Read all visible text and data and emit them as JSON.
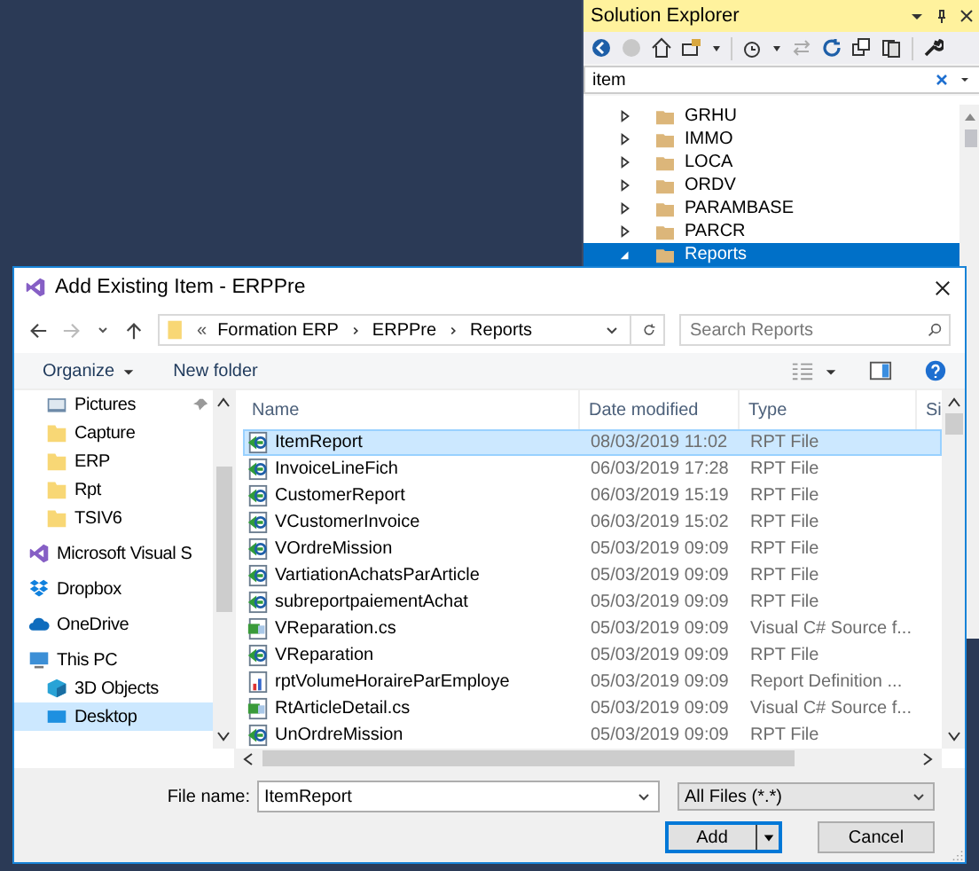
{
  "solution_explorer": {
    "title": "Solution Explorer",
    "search": {
      "value": "item"
    },
    "tree": [
      {
        "label": "GRHU",
        "expanded": false,
        "selected": false
      },
      {
        "label": "IMMO",
        "expanded": false,
        "selected": false
      },
      {
        "label": "LOCA",
        "expanded": false,
        "selected": false
      },
      {
        "label": "ORDV",
        "expanded": false,
        "selected": false
      },
      {
        "label": "PARAMBASE",
        "expanded": false,
        "selected": false
      },
      {
        "label": "PARCR",
        "expanded": false,
        "selected": false
      },
      {
        "label": "Reports",
        "expanded": true,
        "selected": true
      }
    ]
  },
  "dialog": {
    "title": "Add Existing Item - ERPPre",
    "address": {
      "overflow": "«",
      "crumbs": [
        "Formation ERP",
        "ERPPre",
        "Reports"
      ]
    },
    "search": {
      "placeholder": "Search Reports"
    },
    "toolbar": {
      "organize": "Organize",
      "new_folder": "New folder"
    },
    "quick_access": [
      {
        "label": "Pictures",
        "kind": "pictures",
        "pinned": true,
        "selected": false
      },
      {
        "label": "Capture",
        "kind": "folder",
        "pinned": false,
        "selected": false
      },
      {
        "label": "ERP",
        "kind": "folder",
        "pinned": false,
        "selected": false
      },
      {
        "label": "Rpt",
        "kind": "folder",
        "pinned": false,
        "selected": false
      },
      {
        "label": "TSIV6",
        "kind": "folder",
        "pinned": false,
        "selected": false
      }
    ],
    "locations": [
      {
        "label": "Microsoft Visual S",
        "kind": "vs",
        "selected": false
      },
      {
        "label": "Dropbox",
        "kind": "dropbox",
        "selected": false
      },
      {
        "label": "OneDrive",
        "kind": "onedrive",
        "selected": false
      },
      {
        "label": "This PC",
        "kind": "pc",
        "selected": false,
        "children": [
          {
            "label": "3D Objects",
            "kind": "objects3d",
            "selected": false
          },
          {
            "label": "Desktop",
            "kind": "desktop",
            "selected": true
          }
        ]
      }
    ],
    "columns": [
      "Name",
      "Date modified",
      "Type",
      "Si"
    ],
    "files": [
      {
        "name": "ItemReport",
        "date": "08/03/2019 11:02",
        "type": "RPT File",
        "kind": "rpt",
        "selected": true
      },
      {
        "name": "InvoiceLineFich",
        "date": "06/03/2019 17:28",
        "type": "RPT File",
        "kind": "rpt",
        "selected": false
      },
      {
        "name": "CustomerReport",
        "date": "06/03/2019 15:19",
        "type": "RPT File",
        "kind": "rpt",
        "selected": false
      },
      {
        "name": "VCustomerInvoice",
        "date": "06/03/2019 15:02",
        "type": "RPT File",
        "kind": "rpt",
        "selected": false
      },
      {
        "name": "VOrdreMission",
        "date": "05/03/2019 09:09",
        "type": "RPT File",
        "kind": "rpt",
        "selected": false
      },
      {
        "name": "VartiationAchatsParArticle",
        "date": "05/03/2019 09:09",
        "type": "RPT File",
        "kind": "rpt",
        "selected": false
      },
      {
        "name": "subreportpaiementAchat",
        "date": "05/03/2019 09:09",
        "type": "RPT File",
        "kind": "rpt",
        "selected": false
      },
      {
        "name": "VReparation.cs",
        "date": "05/03/2019 09:09",
        "type": "Visual C# Source f...",
        "kind": "cs",
        "selected": false
      },
      {
        "name": "VReparation",
        "date": "05/03/2019 09:09",
        "type": "RPT File",
        "kind": "rpt",
        "selected": false
      },
      {
        "name": "rptVolumeHoraireParEmploye",
        "date": "05/03/2019 09:09",
        "type": "Report Definition ...",
        "kind": "rdl",
        "selected": false
      },
      {
        "name": "RtArticleDetail.cs",
        "date": "05/03/2019 09:09",
        "type": "Visual C# Source f...",
        "kind": "cs",
        "selected": false
      },
      {
        "name": "UnOrdreMission",
        "date": "05/03/2019 09:09",
        "type": "RPT File",
        "kind": "rpt",
        "selected": false
      }
    ],
    "file_name": {
      "label": "File name:",
      "value": "ItemReport"
    },
    "filter": {
      "value": "All Files (*.*)"
    },
    "buttons": {
      "add": "Add",
      "cancel": "Cancel"
    }
  }
}
